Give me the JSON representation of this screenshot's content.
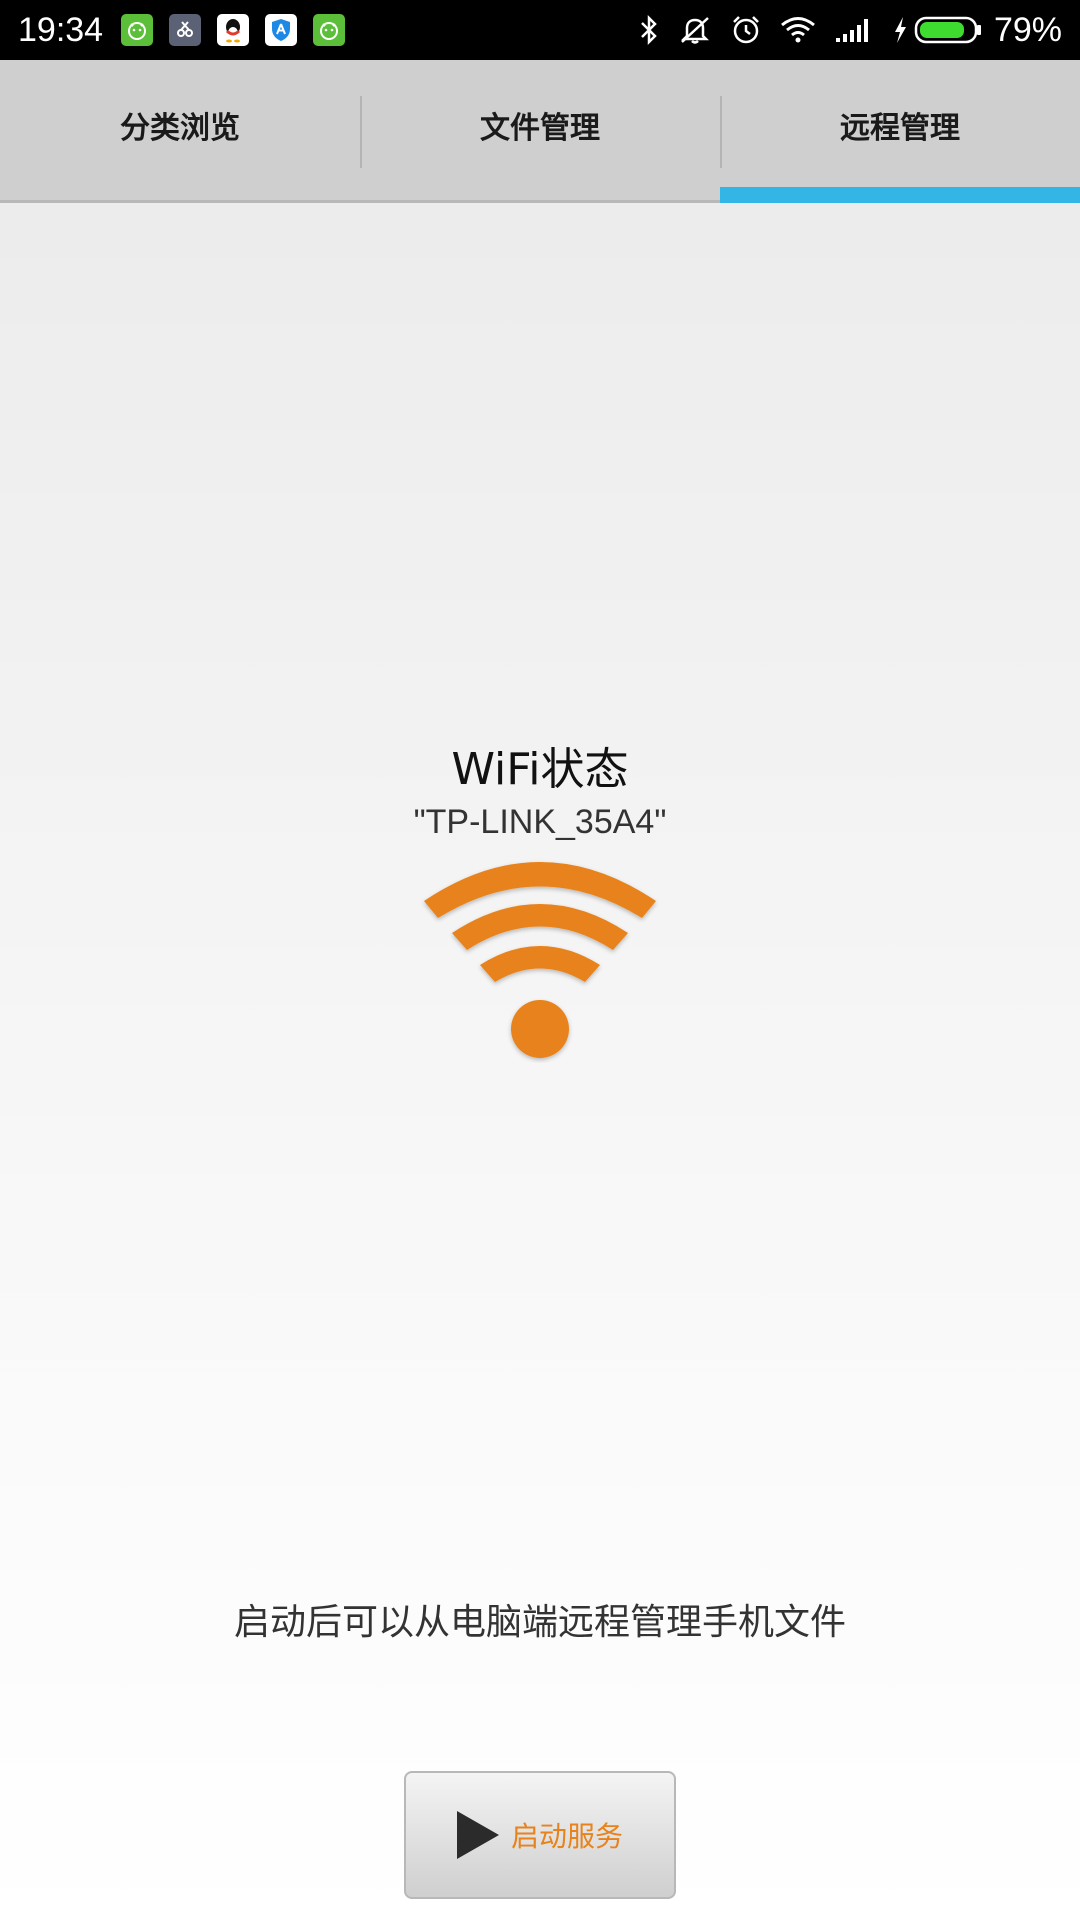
{
  "status_bar": {
    "time": "19:34",
    "notifications": [
      {
        "icon": "android-icon",
        "color": "#5bbf3a",
        "glyph": "☺"
      },
      {
        "icon": "app-icon",
        "color": "#5b6275",
        "glyph": "☒"
      },
      {
        "icon": "qq-penguin-icon",
        "color": "#ffffff",
        "glyph": "🐧"
      },
      {
        "icon": "shield-a-icon",
        "color": "#ffffff",
        "glyph": "A"
      },
      {
        "icon": "android-icon",
        "color": "#5bbf3a",
        "glyph": "☺"
      }
    ],
    "battery_percent": "79%"
  },
  "tabs": [
    {
      "label": "分类浏览",
      "active": false
    },
    {
      "label": "文件管理",
      "active": false
    },
    {
      "label": "远程管理",
      "active": true
    }
  ],
  "main": {
    "wifi_title": "WiFi状态",
    "wifi_ssid": "\"TP-LINK_35A4\"",
    "hint": "启动后可以从电脑端远程管理手机文件",
    "start_button_label": "启动服务"
  },
  "colors": {
    "accent": "#33b5e5",
    "wifi_orange": "#e8821a",
    "button_text": "#e8821a"
  }
}
